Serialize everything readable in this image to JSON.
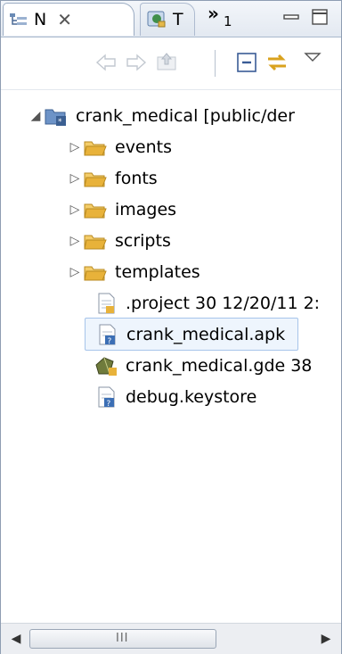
{
  "tabs": {
    "active": {
      "label": "N",
      "icon": "navigator-icon"
    },
    "inactive": {
      "label": "T",
      "icon": "type-hierarchy-icon"
    },
    "overflow_count": "1",
    "overflow_symbol": "»"
  },
  "toolbar": {
    "buttons": [
      "back-icon",
      "forward-icon",
      "up-icon",
      "collapse-all-icon",
      "link-with-editor-icon",
      "view-menu-icon"
    ]
  },
  "tree": {
    "root": {
      "label": "crank_medical [public/der",
      "expanded": true
    },
    "children": [
      {
        "label": "events",
        "type": "folder"
      },
      {
        "label": "fonts",
        "type": "folder"
      },
      {
        "label": "images",
        "type": "folder"
      },
      {
        "label": "scripts",
        "type": "folder"
      },
      {
        "label": "templates",
        "type": "folder"
      },
      {
        "label": ".project",
        "extra": "30  12/20/11 2:",
        "type": "file"
      },
      {
        "label": "crank_medical.apk",
        "type": "file-unknown",
        "selected": true
      },
      {
        "label": "crank_medical.gde",
        "extra": "38",
        "type": "gde"
      },
      {
        "label": "debug.keystore",
        "type": "file-unknown"
      }
    ]
  },
  "scrollbar": {
    "grip": "III"
  },
  "colors": {
    "selection_bg": "#eef5fd",
    "selection_border": "#a6c4ea",
    "folder": "#e8b23a"
  }
}
